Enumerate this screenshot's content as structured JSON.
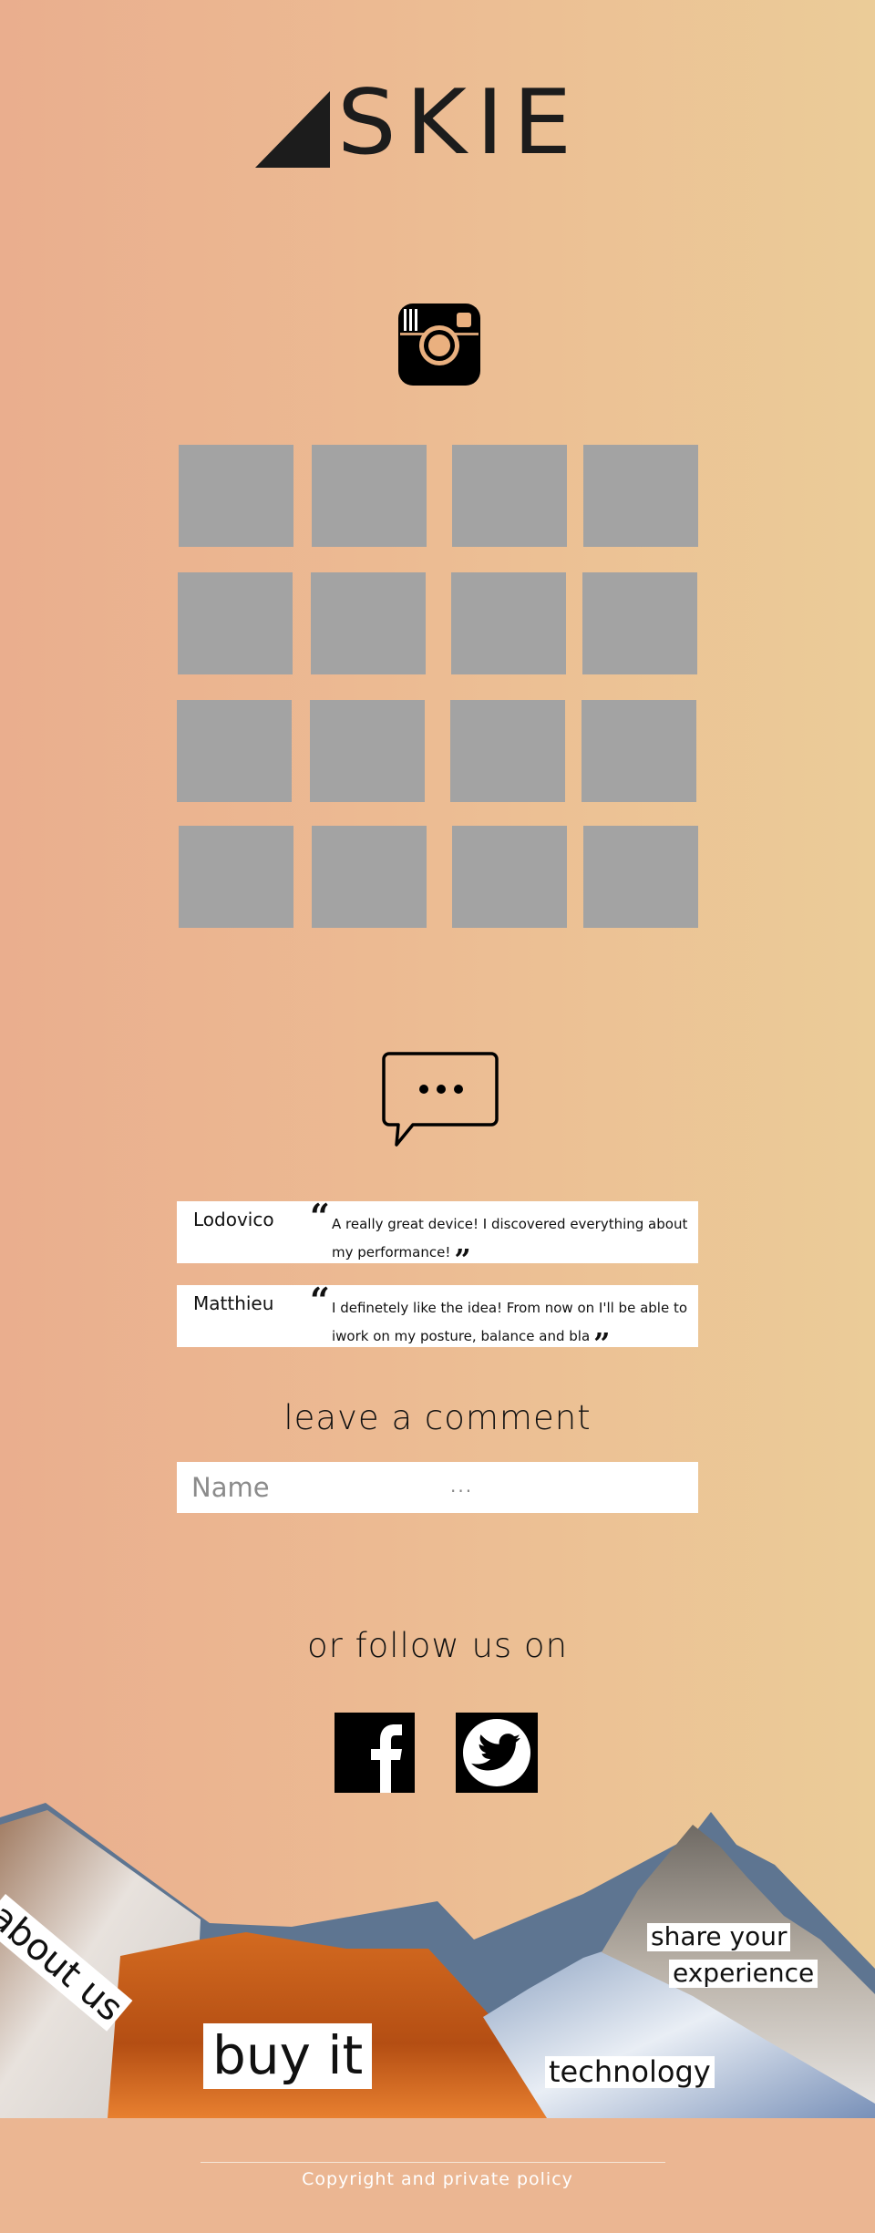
{
  "brand": {
    "name": "SKIE"
  },
  "comments_section": {
    "comments": [
      {
        "author": "Lodovico",
        "text": "A really great device! I discovered everything about my performance!"
      },
      {
        "author": "Matthieu",
        "text": "I definetely like the idea! From now on I'll be able to iwork on my posture, balance and bla"
      }
    ],
    "form_title": "leave a comment",
    "name_placeholder": "Name",
    "dots": "..."
  },
  "follow": {
    "title": "or follow us on"
  },
  "nav": {
    "about": "about us",
    "buy": "buy it",
    "share_line1": "share your",
    "share_line2": "experience",
    "technology": "technology"
  },
  "footer": {
    "text": "Copyright and private policy"
  },
  "icons": {
    "instagram": "instagram-icon",
    "chat": "chat-bubble-icon",
    "facebook": "facebook-icon",
    "twitter": "twitter-icon"
  },
  "colors": {
    "tile": "#a3a3a3",
    "bg_left": "#eaae8e",
    "bg_right": "#ebcc98"
  }
}
